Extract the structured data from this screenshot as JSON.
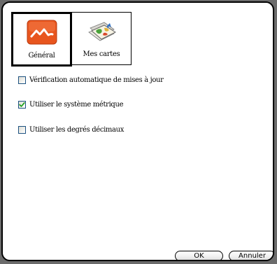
{
  "tabs": [
    {
      "label": "Général",
      "icon": "general-settings-icon",
      "active": true
    },
    {
      "label": "Mes cartes",
      "icon": "map-folder-icon",
      "active": false
    }
  ],
  "options": [
    {
      "label": "Vérification automatique de mises à jour",
      "checked": false
    },
    {
      "label": "Utiliser le système métrique",
      "checked": true
    },
    {
      "label": "Utiliser les degrés décimaux",
      "checked": false
    }
  ],
  "buttons": {
    "ok_label": "OK",
    "cancel_label": "Annuler"
  },
  "colors": {
    "general_icon": "#e8551e",
    "checkbox_border": "#1c5180",
    "check_mark": "#21a121"
  }
}
